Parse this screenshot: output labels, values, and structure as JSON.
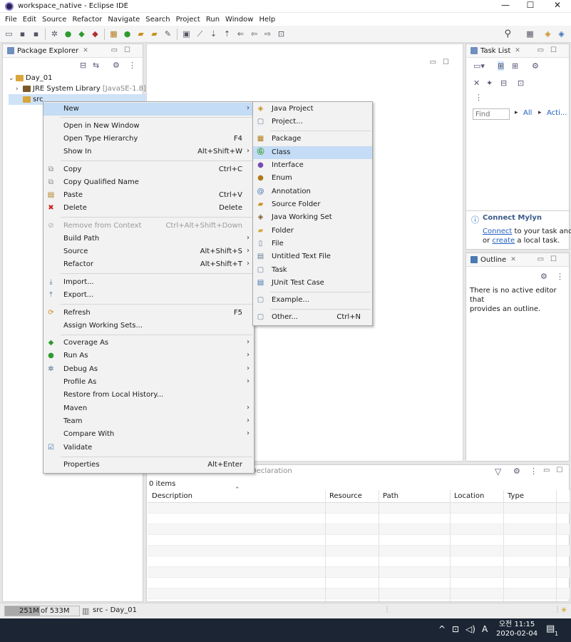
{
  "window": {
    "title": "workspace_native - Eclipse IDE",
    "minimize": "—",
    "maximize": "☐",
    "close": "✕"
  },
  "menubar": [
    "File",
    "Edit",
    "Source",
    "Refactor",
    "Navigate",
    "Search",
    "Project",
    "Run",
    "Window",
    "Help"
  ],
  "package_explorer": {
    "tab": "Package Explorer",
    "tree": [
      {
        "label": "Day_01",
        "extra": ""
      },
      {
        "label": "JRE System Library",
        "extra": "[JavaSE-1.8]"
      },
      {
        "label": "src",
        "extra": ""
      }
    ]
  },
  "context_menu": {
    "new": "New",
    "open_new_window": "Open in New Window",
    "open_type_hierarchy": {
      "label": "Open Type Hierarchy",
      "shortcut": "F4"
    },
    "show_in": {
      "label": "Show In",
      "shortcut": "Alt+Shift+W"
    },
    "copy": {
      "label": "Copy",
      "shortcut": "Ctrl+C"
    },
    "copy_qualified_name": "Copy Qualified Name",
    "paste": {
      "label": "Paste",
      "shortcut": "Ctrl+V"
    },
    "delete": {
      "label": "Delete",
      "shortcut": "Delete"
    },
    "remove_from_context": {
      "label": "Remove from Context",
      "shortcut": "Ctrl+Alt+Shift+Down"
    },
    "build_path": "Build Path",
    "source": {
      "label": "Source",
      "shortcut": "Alt+Shift+S"
    },
    "refactor": {
      "label": "Refactor",
      "shortcut": "Alt+Shift+T"
    },
    "import": "Import...",
    "export": "Export...",
    "refresh": {
      "label": "Refresh",
      "shortcut": "F5"
    },
    "assign_working_sets": "Assign Working Sets...",
    "coverage_as": "Coverage As",
    "run_as": "Run As",
    "debug_as": "Debug As",
    "profile_as": "Profile As",
    "restore_history": "Restore from Local History...",
    "maven": "Maven",
    "team": "Team",
    "compare_with": "Compare With",
    "validate": "Validate",
    "properties": {
      "label": "Properties",
      "shortcut": "Alt+Enter"
    }
  },
  "submenu_new": {
    "java_project": "Java Project",
    "project": "Project...",
    "package": "Package",
    "class": "Class",
    "interface": "Interface",
    "enum": "Enum",
    "annotation": "Annotation",
    "source_folder": "Source Folder",
    "java_working_set": "Java Working Set",
    "folder": "Folder",
    "file": "File",
    "untitled_text_file": "Untitled Text File",
    "task": "Task",
    "junit_test_case": "JUnit Test Case",
    "example": "Example...",
    "other": {
      "label": "Other...",
      "shortcut": "Ctrl+N"
    }
  },
  "task_list": {
    "tab": "Task List",
    "find_placeholder": "Find",
    "all": "All",
    "activate": "Acti..."
  },
  "mylyn": {
    "title": "Connect Mylyn",
    "connect_link": "Connect",
    "line1_rest": " to your task and A",
    "line2_prefix": "or ",
    "create_link": "create",
    "line2_rest": " a local task."
  },
  "outline": {
    "tab": "Outline",
    "message1": "There is no active editor that",
    "message2": "provides an outline."
  },
  "bottom_panel": {
    "declaration_tab": "Declaration",
    "item_count": "0 items",
    "columns": [
      "Description",
      "Resource",
      "Path",
      "Location",
      "Type"
    ]
  },
  "status": {
    "heap_used": "251M",
    "heap_total": "of 533M",
    "heap_fraction": 0.47,
    "selection": "src - Day_01"
  },
  "taskbar": {
    "ime": "A",
    "time": "오전 11:15",
    "date": "2020-02-04",
    "notifications": "1"
  },
  "colors": {
    "selection": "#c4dcf5",
    "link": "#1f5fbf",
    "taskbar": "#1b2533"
  }
}
